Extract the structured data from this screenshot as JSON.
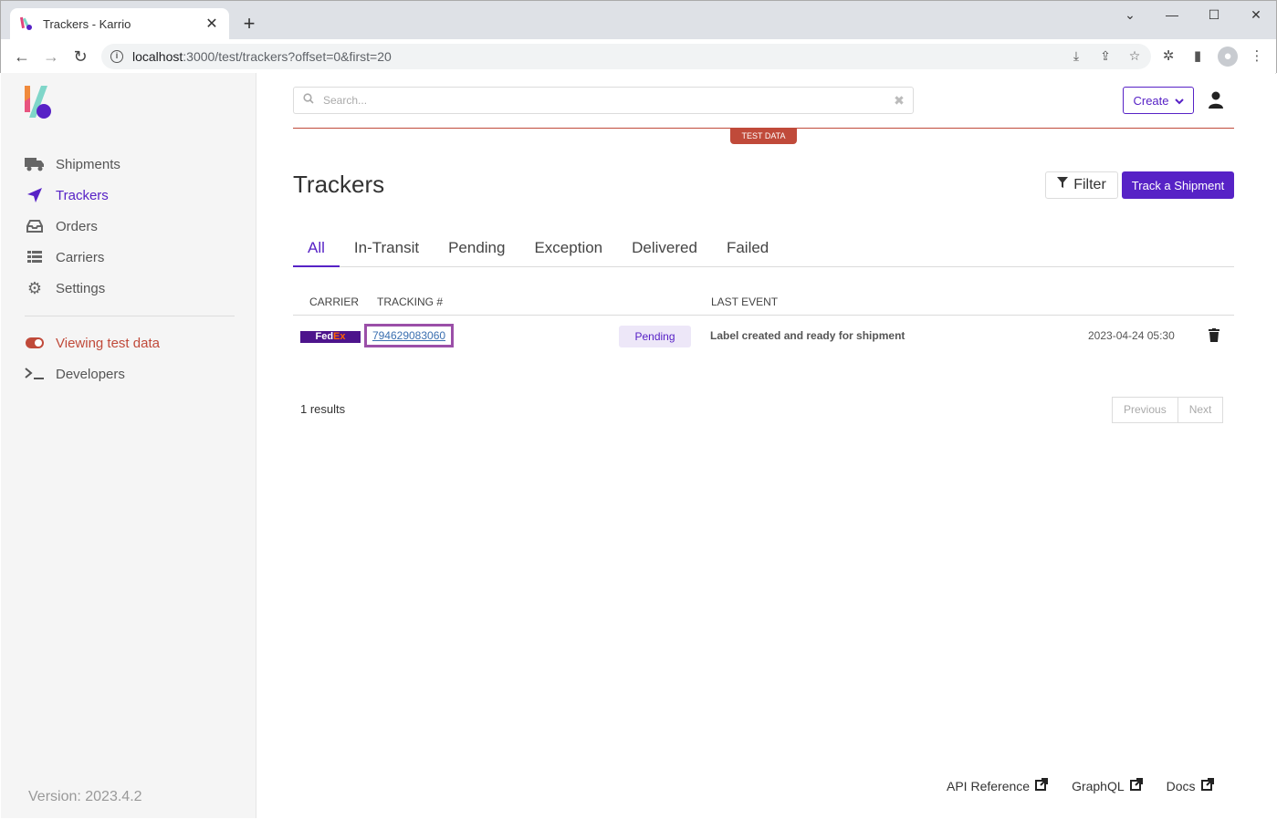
{
  "browser": {
    "tab_title": "Trackers - Karrio",
    "url_host": "localhost",
    "url_rest": ":3000/test/trackers?offset=0&first=20"
  },
  "sidebar": {
    "items": [
      {
        "label": "Shipments",
        "icon": "truck-icon"
      },
      {
        "label": "Trackers",
        "icon": "location-arrow-icon"
      },
      {
        "label": "Orders",
        "icon": "inbox-icon"
      },
      {
        "label": "Carriers",
        "icon": "list-icon"
      },
      {
        "label": "Settings",
        "icon": "gear-icon"
      }
    ],
    "test_mode_label": "Viewing test data",
    "developers_label": "Developers",
    "version": "Version: 2023.4.2"
  },
  "header": {
    "search_placeholder": "Search...",
    "create_label": "Create",
    "test_badge": "TEST DATA"
  },
  "page": {
    "title": "Trackers",
    "filter_label": "Filter",
    "track_label": "Track a Shipment",
    "tabs": [
      "All",
      "In-Transit",
      "Pending",
      "Exception",
      "Delivered",
      "Failed"
    ],
    "active_tab": "All"
  },
  "table": {
    "columns": [
      "CARRIER",
      "TRACKING #",
      "LAST EVENT"
    ],
    "rows": [
      {
        "carrier": "FedEx",
        "carrier_logo_a": "Fed",
        "carrier_logo_b": "Ex",
        "tracking": "794629083060",
        "status": "Pending",
        "last_event": "Label created and ready for shipment",
        "date": "2023-04-24 05:30"
      }
    ]
  },
  "pagination": {
    "results": "1 results",
    "previous": "Previous",
    "next": "Next"
  },
  "footer": {
    "api_reference": "API Reference",
    "graphql": "GraphQL",
    "docs": "Docs"
  },
  "colors": {
    "accent": "#5722c6",
    "test_red": "#c04a3a"
  }
}
